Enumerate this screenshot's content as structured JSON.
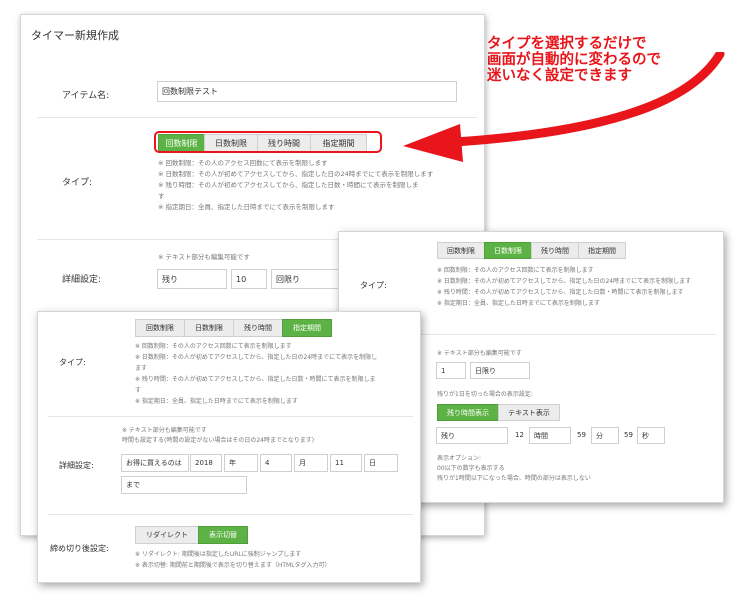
{
  "callout": {
    "line1": "タイプを選択するだけで",
    "line2": "画面が自動的に変わるので",
    "line3": "迷いなく設定できます"
  },
  "main": {
    "title": "タイマー新規作成",
    "item_label": "アイテム名:",
    "item_value": "回数制限テスト",
    "type_label": "タイプ:",
    "type_buttons": [
      "回数制限",
      "日数制限",
      "残り時間",
      "指定期間"
    ],
    "type_selected": "回数制限",
    "notes": [
      "※ 回数制限：その人のアクセス回数にて表示を制限します",
      "※ 日数制限：その人が初めてアクセスしてから、指定した日の24時までにて表示を制限します",
      "※ 残り時間：その人が初めてアクセスしてから、指定した日数・時間にて表示を制限しま",
      "す",
      "※ 指定期日：全員、指定した日時までにて表示を制限します"
    ],
    "detail_label": "詳細設定:",
    "detail_note": "※ テキスト部分も編集可能です",
    "detail_prefix": "残り",
    "detail_count": "10",
    "detail_suffix": "回限り"
  },
  "right": {
    "type_label": "タイプ:",
    "type_selected": "日数制限",
    "notes": [
      "※ 回数制限：その人のアクセス回数にて表示を制限します",
      "※ 日数制限：その人が初めてアクセスしてから、指定した日の24時までにて表示を制限します",
      "※ 残り時間：その人が初めてアクセスしてから、指定した日数・時間にて表示を制限します",
      "※ 指定期日：全員、指定した日時までにて表示を制限します"
    ],
    "edit_note": "※ テキスト部分も編集可能です",
    "days_value": "1",
    "days_suffix": "日限り",
    "under1_note": "残りが1日を切った場合の表示設定:",
    "toggle": [
      "残り時間表示",
      "テキスト表示"
    ],
    "toggle_selected": "残り時間表示",
    "remain_prefix": "残り",
    "hours": "12",
    "hours_unit": "時間",
    "minutes": "59",
    "minutes_unit": "分",
    "seconds": "59",
    "seconds_unit": "秒",
    "option_title": "表示オプション:",
    "option_1": "00以下の数字も表示する",
    "option_2": "残りが1時間以下になった場合、時間の部分は表示しない"
  },
  "left": {
    "type_label": "タイプ:",
    "type_selected": "指定期間",
    "notes": [
      "※ 回数制限：その人のアクセス回数にて表示を制限します",
      "※ 日数制限：その人が初めてアクセスしてから、指定した日の24時までにて表示を制限し",
      "ます",
      "※ 残り時間：その人が初めてアクセスしてから、指定した日数・時間にて表示を制限しま",
      "す",
      "※ 指定期日：全員、指定した日時までにて表示を制限します"
    ],
    "detail_label": "詳細設定:",
    "detail_note_1": "※ テキスト部分も編集可能です",
    "detail_note_2": "時間も設定する(時間の設定がない場合はその日の24時までとなります)",
    "prefix": "お得に買えるのは",
    "year": "2018",
    "year_unit": "年",
    "month": "4",
    "month_unit": "月",
    "day": "11",
    "day_unit": "日",
    "suffix": "まで",
    "after_label": "締め切り後設定:",
    "after_buttons": [
      "リダイレクト",
      "表示切替"
    ],
    "after_selected": "表示切替",
    "after_note_1": "※ リダイレクト: 期間後は指定したURLに強制ジャンプします",
    "after_note_2": "※ 表示切替: 期間前と期間後で表示を切り替えます（HTMLタグ入力可）"
  }
}
